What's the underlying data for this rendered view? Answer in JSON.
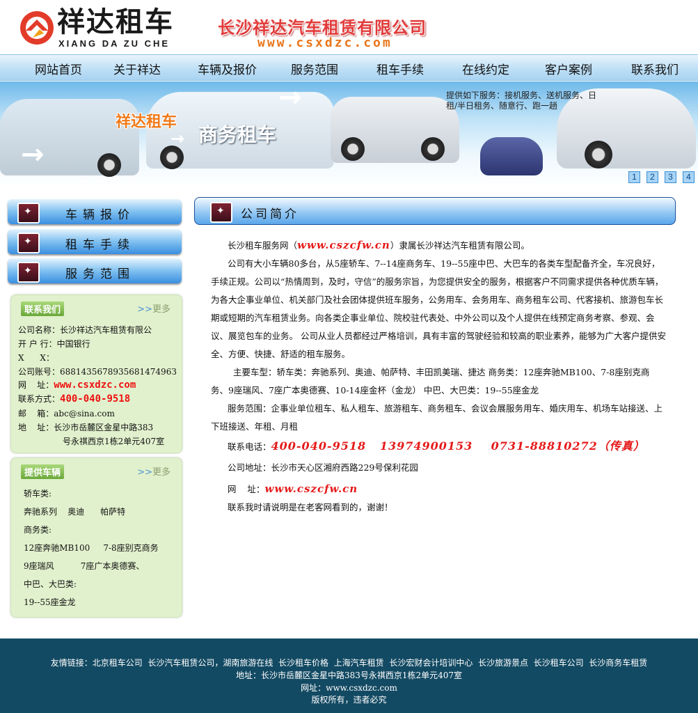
{
  "header": {
    "logo_text": "祥达租车",
    "logo_pinyin": "XIANG DA ZU CHE",
    "company_name": "长沙祥达汽车租赁有限公司",
    "company_url": "www.csxdzc.com"
  },
  "nav": {
    "items": [
      "网站首页",
      "关于祥达",
      "车辆及报价",
      "服务范围",
      "租车手续",
      "在线约定",
      "客户案例",
      "联系我们"
    ]
  },
  "banner": {
    "brand": "祥达租车",
    "title": "商务租车",
    "description": "提供如下服务：接机服务、送机服务、日租/半日租务、随意行、跑一趟",
    "pages": [
      "1",
      "2",
      "3",
      "4"
    ]
  },
  "side_menu": {
    "items": [
      "车辆报价",
      "租车手续",
      "服务范围"
    ]
  },
  "contact_panel": {
    "tag": "联系我们",
    "more": "更多",
    "rows": {
      "company": "公司名称：长沙祥达汽车租赁有限公",
      "bank": "开 户 行：中国银行",
      "x": "X      X：",
      "account": "公司账号：688143567893568147496З",
      "website_label": "网    址：",
      "website": "www.csxdzc.com",
      "phone_label": "联系方式：",
      "phone": "400-040-9518",
      "email": "邮    箱：abc@sina.com",
      "address1": "地    址：长沙市岳麓区金星中路383",
      "address2": "号永祺西京1栋2单元407室"
    }
  },
  "vehicles_panel": {
    "tag": "提供车辆",
    "more": "更多",
    "rows": [
      "轿车类:",
      "奔驰系列    奥迪      帕萨特",
      "商务类:",
      "12座奔驰MB100     7-8座别克商务",
      "9座瑞风          7座广本奥德赛、",
      "中巴、大巴类:",
      "19--55座金龙"
    ]
  },
  "main": {
    "section_title": "公司简介",
    "intro_prefix": "长沙租车服务网（",
    "intro_url": "www.cszcfw.cn",
    "intro_suffix": "）隶属长沙祥达汽车租赁有限公司。",
    "para1": "公司有大小车辆80多台，从5座轿车、7--14座商务车、19--55座中巴、大巴车的各类车型配备齐全，车况良好，手续正规。公司以“热情周到，及时，守信”的服务宗旨，为您提供安全的服务，根据客户不同需求提供各种优质车辆，为各大企事业单位、机关部门及社会团体提供班车服务，公务用车、会务用车、商务租车公司、代客接机、旅游包车长期或短期的汽车租赁业务。向各类企事业单位、院校驻代表处、中外公司以及个人提供在线预定商务考察、参观、会议、展览包车的业务。 公司从业人员都经过严格培训，具有丰富的驾驶经验和较高的职业素养，能够为广大客户提供安全、方便、快捷、舒适的租车服务。",
    "para2": "主要车型：轿车类：奔驰系列、奥迪、帕萨特、丰田凯美瑞、捷达   商务类：12座奔驰MB100、7-8座别克商务、9座瑞风、7座广本奥德赛、10-14座金杯（金龙）   中巴、大巴类：19--55座金龙",
    "para3": "服务范围：企事业单位租车、私人租车、旅游租车、商务租车、会议会展服务用车、婚庆用车、机场车站接送、上下班接送、年租、月租",
    "phone_label": "联系电话：",
    "phone": "400-040-9518   13974900153    0731-88810272（传真）",
    "address": "公司地址：长沙市天心区湘府西路229号保利花园",
    "website_label": "网    址：",
    "website": "www.cszcfw.cn",
    "closing": "联系我时请说明是在老客网看到的，谢谢！"
  },
  "footer": {
    "links_label": "友情链接：",
    "links": [
      "北京租车公司",
      "长沙汽车租赁公司，湖南旅游在线",
      "长沙租车价格",
      "上海汽车租赁",
      "长沙宏财会计培训中心",
      "长沙旅游景点",
      "长沙租车公司",
      "长沙商务车租赁"
    ],
    "address": "地址：长沙市岳麓区金星中路383号永祺西京1栋2单元407室",
    "website": "网址：www.csxdzc.com",
    "copyright": "版权所有，违者必究"
  }
}
